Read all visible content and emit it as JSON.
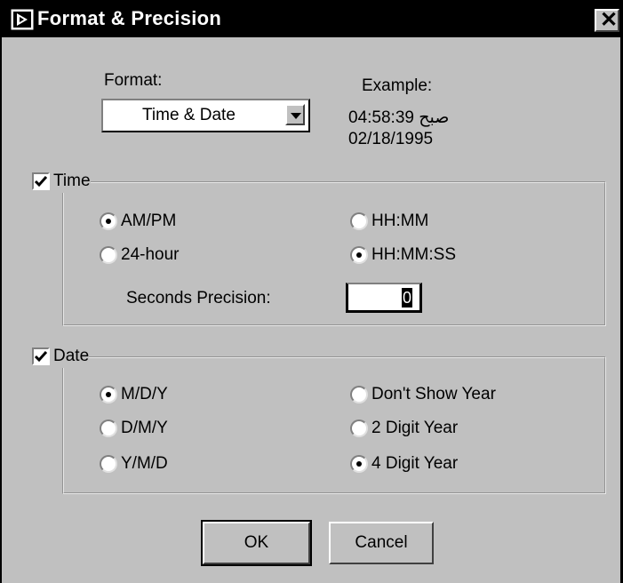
{
  "window": {
    "title": "Format & Precision",
    "close_glyph": "✕"
  },
  "format": {
    "label": "Format:",
    "selected": "Time & Date"
  },
  "example": {
    "label": "Example:",
    "line1": "04:58:39 صبح",
    "line2": "02/18/1995"
  },
  "time_group": {
    "label": "Time",
    "checked": true,
    "am_pm": "AM/PM",
    "hour24": "24-hour",
    "hhmm": "HH:MM",
    "hhmmss": "HH:MM:SS",
    "seconds_precision_label": "Seconds Precision:",
    "seconds_precision_value": "0"
  },
  "date_group": {
    "label": "Date",
    "checked": true,
    "mdy": "M/D/Y",
    "dmy": "D/M/Y",
    "ymd": "Y/M/D",
    "dont_show_year": "Don't Show Year",
    "two_digit": "2 Digit Year",
    "four_digit": "4 Digit Year"
  },
  "buttons": {
    "ok": "OK",
    "cancel": "Cancel"
  },
  "colors": {
    "face": "#c0c0c0",
    "titlebar": "#000000"
  },
  "icons": [
    "labview-app-icon",
    "close-icon",
    "dropdown-arrow-icon",
    "checkbox-icon",
    "radio-icon"
  ]
}
